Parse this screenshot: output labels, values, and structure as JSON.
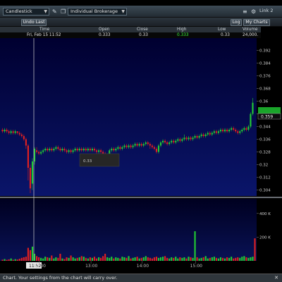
{
  "toolbar": {
    "chart_type": "Candlestick",
    "account": "Individual Brokerage",
    "link": "Link 2"
  },
  "actions": {
    "undo_last": "Undo Last",
    "log": "Log",
    "my_charts": "My Charts"
  },
  "quote": {
    "headers": [
      "Time",
      "Open",
      "Close",
      "High",
      "Low",
      "Volume"
    ],
    "time": "Fri, Feb 15  11:52",
    "open": "0.333",
    "close": "0.33",
    "high": "0.333",
    "low": "0.33",
    "volume": "24,000."
  },
  "colors": {
    "up": "#22cc33",
    "down": "#e02020",
    "high_highlight": "#3cff3c",
    "price_bg_top": "#000044",
    "price_bg_bottom": "#07105c"
  },
  "chart_data": {
    "type": "candlestick",
    "price_axis": {
      "ticks": [
        "0.392",
        "0.384",
        "0.376",
        "0.368",
        "0.36",
        "0.352",
        "0.344",
        "0.336",
        "0.328",
        "0.32",
        "0.312",
        "0.304"
      ],
      "ylim": [
        0.302,
        0.398
      ]
    },
    "last_price_label": "0.359",
    "tooltip_text": "0.33",
    "crosshair_time_label": "11:52",
    "volume_axis": {
      "ticks": [
        "400 K",
        "200 K"
      ],
      "ylim": [
        0,
        500000
      ]
    },
    "time_labels": [
      "12:00",
      "13:00",
      "14:00",
      "15:00"
    ],
    "candles": [
      [
        0.342,
        0.341,
        0.343,
        0.34
      ],
      [
        0.341,
        0.342,
        0.343,
        0.34
      ],
      [
        0.342,
        0.341,
        0.343,
        0.34
      ],
      [
        0.341,
        0.34,
        0.342,
        0.339
      ],
      [
        0.34,
        0.341,
        0.342,
        0.339
      ],
      [
        0.341,
        0.34,
        0.342,
        0.339
      ],
      [
        0.34,
        0.341,
        0.342,
        0.339
      ],
      [
        0.341,
        0.34,
        0.341,
        0.339
      ],
      [
        0.34,
        0.339,
        0.341,
        0.338
      ],
      [
        0.339,
        0.338,
        0.34,
        0.337
      ],
      [
        0.338,
        0.336,
        0.339,
        0.335
      ],
      [
        0.336,
        0.332,
        0.337,
        0.33
      ],
      [
        0.332,
        0.318,
        0.333,
        0.31
      ],
      [
        0.318,
        0.305,
        0.32,
        0.302
      ],
      [
        0.308,
        0.322,
        0.324,
        0.304
      ],
      [
        0.322,
        0.33,
        0.331,
        0.32
      ],
      [
        0.329,
        0.328,
        0.331,
        0.327
      ],
      [
        0.328,
        0.327,
        0.329,
        0.326
      ],
      [
        0.327,
        0.328,
        0.329,
        0.326
      ],
      [
        0.328,
        0.329,
        0.33,
        0.327
      ],
      [
        0.329,
        0.33,
        0.331,
        0.328
      ],
      [
        0.33,
        0.329,
        0.331,
        0.328
      ],
      [
        0.329,
        0.33,
        0.331,
        0.328
      ],
      [
        0.33,
        0.329,
        0.331,
        0.328
      ],
      [
        0.329,
        0.33,
        0.331,
        0.328
      ],
      [
        0.33,
        0.331,
        0.332,
        0.329
      ],
      [
        0.331,
        0.33,
        0.332,
        0.329
      ],
      [
        0.33,
        0.329,
        0.331,
        0.328
      ],
      [
        0.329,
        0.33,
        0.331,
        0.328
      ],
      [
        0.33,
        0.329,
        0.331,
        0.328
      ],
      [
        0.329,
        0.328,
        0.33,
        0.327
      ],
      [
        0.328,
        0.329,
        0.33,
        0.327
      ],
      [
        0.329,
        0.328,
        0.33,
        0.327
      ],
      [
        0.328,
        0.329,
        0.33,
        0.327
      ],
      [
        0.329,
        0.33,
        0.331,
        0.328
      ],
      [
        0.33,
        0.329,
        0.331,
        0.328
      ],
      [
        0.329,
        0.33,
        0.331,
        0.328
      ],
      [
        0.33,
        0.329,
        0.331,
        0.328
      ],
      [
        0.329,
        0.33,
        0.331,
        0.328
      ],
      [
        0.33,
        0.329,
        0.331,
        0.328
      ],
      [
        0.329,
        0.33,
        0.331,
        0.328
      ],
      [
        0.33,
        0.329,
        0.331,
        0.328
      ],
      [
        0.329,
        0.33,
        0.331,
        0.328
      ],
      [
        0.33,
        0.329,
        0.331,
        0.328
      ],
      [
        0.329,
        0.328,
        0.33,
        0.327
      ],
      [
        0.328,
        0.329,
        0.33,
        0.327
      ],
      [
        0.329,
        0.328,
        0.33,
        0.327
      ],
      [
        0.328,
        0.327,
        0.329,
        0.326
      ],
      [
        0.327,
        0.323,
        0.328,
        0.322
      ],
      [
        0.323,
        0.326,
        0.327,
        0.322
      ],
      [
        0.326,
        0.329,
        0.33,
        0.325
      ],
      [
        0.329,
        0.33,
        0.331,
        0.328
      ],
      [
        0.33,
        0.329,
        0.331,
        0.328
      ],
      [
        0.329,
        0.33,
        0.331,
        0.328
      ],
      [
        0.33,
        0.331,
        0.332,
        0.329
      ],
      [
        0.331,
        0.33,
        0.332,
        0.329
      ],
      [
        0.33,
        0.331,
        0.332,
        0.329
      ],
      [
        0.331,
        0.332,
        0.333,
        0.33
      ],
      [
        0.332,
        0.331,
        0.333,
        0.33
      ],
      [
        0.331,
        0.332,
        0.333,
        0.33
      ],
      [
        0.332,
        0.331,
        0.333,
        0.33
      ],
      [
        0.331,
        0.332,
        0.333,
        0.33
      ],
      [
        0.332,
        0.333,
        0.334,
        0.331
      ],
      [
        0.333,
        0.332,
        0.334,
        0.331
      ],
      [
        0.332,
        0.333,
        0.334,
        0.331
      ],
      [
        0.333,
        0.332,
        0.334,
        0.331
      ],
      [
        0.332,
        0.333,
        0.334,
        0.331
      ],
      [
        0.333,
        0.334,
        0.335,
        0.332
      ],
      [
        0.334,
        0.333,
        0.335,
        0.332
      ],
      [
        0.333,
        0.332,
        0.334,
        0.33
      ],
      [
        0.332,
        0.331,
        0.333,
        0.33
      ],
      [
        0.331,
        0.33,
        0.332,
        0.329
      ],
      [
        0.33,
        0.328,
        0.331,
        0.327
      ],
      [
        0.328,
        0.332,
        0.333,
        0.327
      ],
      [
        0.332,
        0.334,
        0.335,
        0.331
      ],
      [
        0.334,
        0.335,
        0.336,
        0.333
      ],
      [
        0.335,
        0.334,
        0.336,
        0.333
      ],
      [
        0.334,
        0.333,
        0.335,
        0.332
      ],
      [
        0.333,
        0.334,
        0.335,
        0.332
      ],
      [
        0.334,
        0.335,
        0.336,
        0.333
      ],
      [
        0.335,
        0.334,
        0.336,
        0.333
      ],
      [
        0.334,
        0.335,
        0.336,
        0.333
      ],
      [
        0.335,
        0.336,
        0.337,
        0.334
      ],
      [
        0.336,
        0.335,
        0.337,
        0.334
      ],
      [
        0.335,
        0.336,
        0.337,
        0.334
      ],
      [
        0.336,
        0.337,
        0.339,
        0.335
      ],
      [
        0.337,
        0.336,
        0.338,
        0.335
      ],
      [
        0.336,
        0.337,
        0.338,
        0.335
      ],
      [
        0.337,
        0.336,
        0.338,
        0.335
      ],
      [
        0.336,
        0.337,
        0.338,
        0.335
      ],
      [
        0.337,
        0.338,
        0.339,
        0.336
      ],
      [
        0.338,
        0.337,
        0.339,
        0.336
      ],
      [
        0.337,
        0.338,
        0.339,
        0.336
      ],
      [
        0.338,
        0.339,
        0.34,
        0.337
      ],
      [
        0.339,
        0.338,
        0.34,
        0.337
      ],
      [
        0.338,
        0.339,
        0.34,
        0.337
      ],
      [
        0.339,
        0.34,
        0.341,
        0.338
      ],
      [
        0.34,
        0.339,
        0.341,
        0.338
      ],
      [
        0.339,
        0.34,
        0.341,
        0.338
      ],
      [
        0.34,
        0.341,
        0.342,
        0.339
      ],
      [
        0.341,
        0.34,
        0.342,
        0.339
      ],
      [
        0.34,
        0.341,
        0.342,
        0.339
      ],
      [
        0.341,
        0.342,
        0.343,
        0.34
      ],
      [
        0.342,
        0.341,
        0.343,
        0.34
      ],
      [
        0.341,
        0.342,
        0.343,
        0.34
      ],
      [
        0.342,
        0.341,
        0.343,
        0.34
      ],
      [
        0.341,
        0.342,
        0.343,
        0.34
      ],
      [
        0.342,
        0.343,
        0.344,
        0.341
      ],
      [
        0.343,
        0.342,
        0.344,
        0.341
      ],
      [
        0.342,
        0.341,
        0.343,
        0.34
      ],
      [
        0.341,
        0.34,
        0.342,
        0.339
      ],
      [
        0.34,
        0.341,
        0.342,
        0.339
      ],
      [
        0.341,
        0.342,
        0.343,
        0.34
      ],
      [
        0.342,
        0.343,
        0.344,
        0.341
      ],
      [
        0.343,
        0.342,
        0.344,
        0.341
      ],
      [
        0.342,
        0.344,
        0.345,
        0.341
      ],
      [
        0.344,
        0.352,
        0.353,
        0.343
      ],
      [
        0.352,
        0.359,
        0.362,
        0.351
      ]
    ],
    "volume": [
      10000,
      15000,
      8000,
      12000,
      20000,
      9000,
      14000,
      11000,
      18000,
      25000,
      30000,
      35000,
      110000,
      90000,
      120000,
      60000,
      40000,
      30000,
      25000,
      20000,
      35000,
      30000,
      25000,
      45000,
      20000,
      30000,
      25000,
      60000,
      20000,
      15000,
      30000,
      25000,
      45000,
      30000,
      20000,
      25000,
      30000,
      40000,
      35000,
      25000,
      20000,
      30000,
      25000,
      35000,
      20000,
      30000,
      25000,
      40000,
      60000,
      30000,
      25000,
      35000,
      20000,
      30000,
      25000,
      20000,
      35000,
      30000,
      25000,
      40000,
      20000,
      25000,
      30000,
      35000,
      20000,
      25000,
      30000,
      40000,
      30000,
      25000,
      20000,
      30000,
      35000,
      25000,
      30000,
      35000,
      40000,
      25000,
      20000,
      30000,
      25000,
      35000,
      20000,
      30000,
      25000,
      30000,
      20000,
      35000,
      30000,
      25000,
      250000,
      30000,
      20000,
      25000,
      30000,
      40000,
      20000,
      25000,
      30000,
      35000,
      25000,
      20000,
      30000,
      25000,
      20000,
      30000,
      25000,
      35000,
      20000,
      25000,
      30000,
      25000,
      35000,
      40000,
      30000,
      25000,
      30000,
      35000,
      190000
    ]
  },
  "status_text": "Chart. Your settings from the chart will carry over."
}
